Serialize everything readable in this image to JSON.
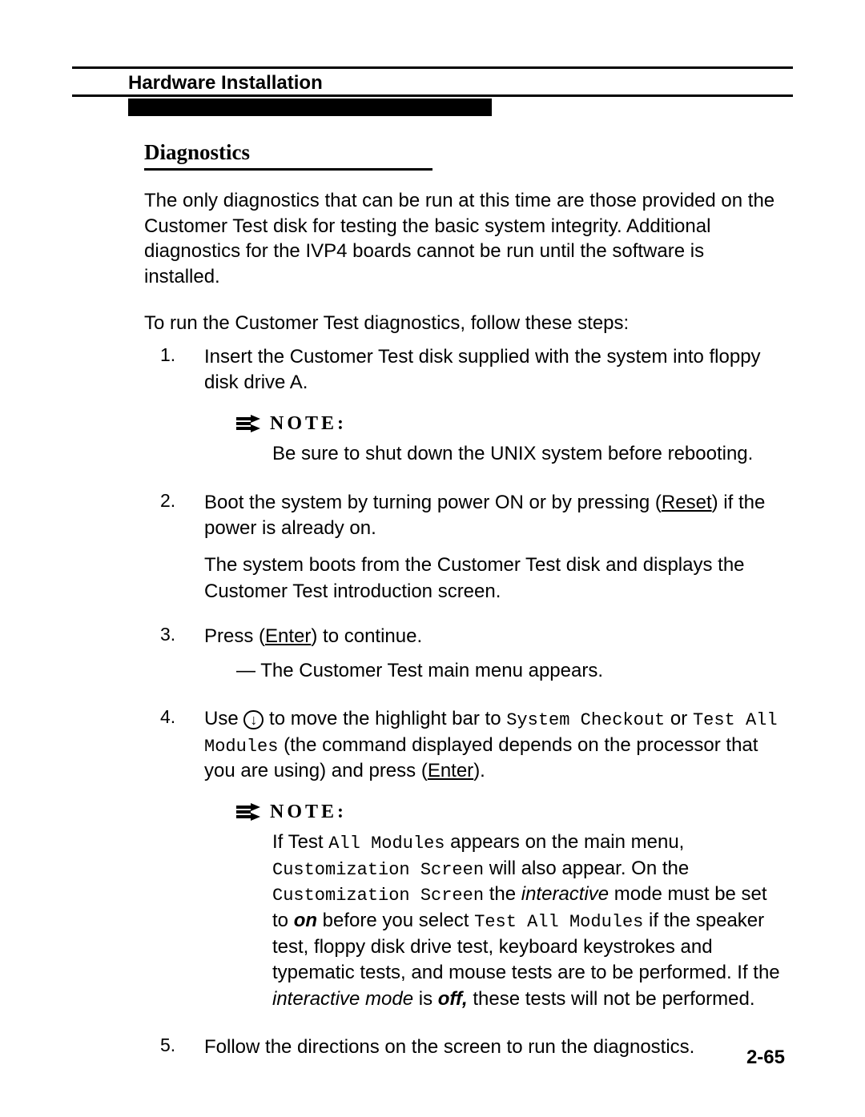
{
  "header": {
    "title": "Hardware Installation"
  },
  "section": {
    "title": "Diagnostics"
  },
  "intro": "The only diagnostics that can be run at this time are those provided on the Customer Test disk for testing the basic system integrity. Additional diagnostics for the IVP4 boards cannot be run until the software is installed.",
  "steps_intro": "To run the Customer Test diagnostics, follow these steps:",
  "steps": {
    "s1": {
      "num": "1.",
      "text_a": "Insert ",
      "text_b": "the Customer Test disk supplied with the system into floppy disk drive A."
    },
    "note1": {
      "label": "NOTE:",
      "body": "Be sure to shut down the UNIX system before rebooting."
    },
    "s2": {
      "num": "2.",
      "pre": "Boot the system by turning power ON or by pressing (",
      "key": "Reset",
      "post": ") if the power is already on.",
      "para2": "The system boots from the Customer Test disk and displays the Customer Test introduction screen."
    },
    "s3": {
      "num": "3.",
      "pre": "Press (",
      "key": "Enter",
      "post": ") to continue.",
      "sub": "— The Customer Test main menu appears."
    },
    "s4": {
      "num": "4.",
      "a": "Use",
      "b": " to move the highlight bar to ",
      "c1": "System Checkout",
      "d": " or ",
      "c2": "Test All Modules",
      "e": " (the command displayed depends on the processor that you are using) and press (",
      "key": "Enter",
      "f": ")."
    },
    "note2": {
      "label": "NOTE:",
      "t1": "If Test ",
      "m1": "All Modules",
      "t2": " appears on the main menu, ",
      "m2": "Customization Screen",
      "t3": " will also appear. On the ",
      "m3": "Customization Screen",
      "t4": " the ",
      "i1": "interactive",
      "t5": " mode must be set to ",
      "b1": "on",
      "t6": " before you select ",
      "m4": "Test All Modules",
      "t7": " if the speaker test, floppy disk drive test, keyboard keystrokes and typematic tests, and mouse tests are to be performed. If the ",
      "i2": "interactive mode",
      "t8": " is ",
      "b2": "off,",
      "t9": " these tests will not be performed."
    },
    "s5": {
      "num": "5.",
      "text": "Follow the directions on the screen to run the diagnostics."
    }
  },
  "page_num": "2-65"
}
